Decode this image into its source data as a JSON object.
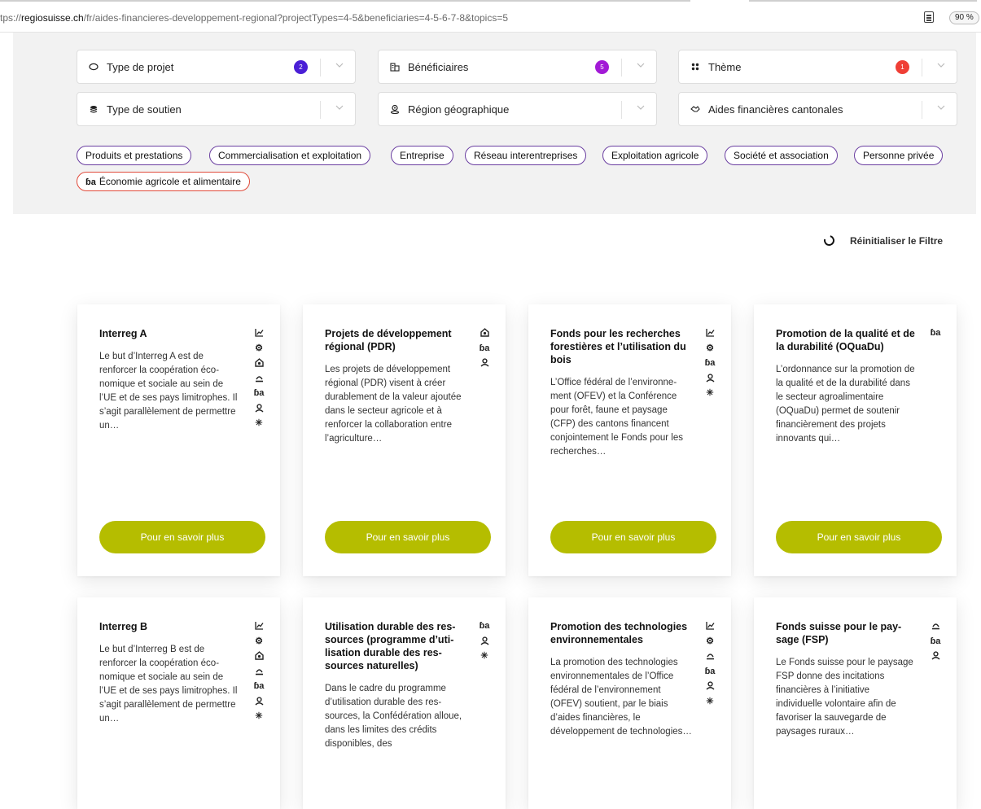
{
  "browser": {
    "url_prefix": "tps://",
    "url_domain": "regiosuisse.ch",
    "url_path": "/fr/aides-financieres-developpement-regional?projectTypes=4-5&beneficiaries=4-5-6-7-8&topics=5",
    "zoom": "90 %",
    "reader_icon": "reader-view-icon"
  },
  "filters": {
    "type_projet": {
      "label": "Type de projet",
      "badge": "2",
      "badge_color": "#4a1fd6",
      "icon": "circle-outline-icon"
    },
    "beneficiaires": {
      "label": "Bénéficiaires",
      "badge": "5",
      "badge_color": "#a21ad6",
      "icon": "building-icon"
    },
    "theme": {
      "label": "Thème",
      "badge": "1",
      "badge_color": "#ef3f36",
      "icon": "grid-icon"
    },
    "type_soutien": {
      "label": "Type de soutien",
      "icon": "coins-icon"
    },
    "region": {
      "label": "Région géographique",
      "icon": "location-icon"
    },
    "cantonales": {
      "label": "Aides financières cantonales",
      "icon": "handshake-icon"
    }
  },
  "chips": [
    {
      "label": "Produits et prestations"
    },
    {
      "label": "Commercialisation et exploitation"
    },
    {
      "label": "Entreprise"
    },
    {
      "label": "Réseau interentreprises"
    },
    {
      "label": "Exploitation agricole"
    },
    {
      "label": "Société et association"
    },
    {
      "label": "Personne privée"
    },
    {
      "label": "Économie agricole et alimentaire",
      "icon": "tractor-icon"
    }
  ],
  "reset_label": "Réinitialiser le Filtre",
  "button_label": "Pour en savoir plus",
  "cards": [
    {
      "title": "Interreg A",
      "desc": "Le but d’Interreg A est de renforcer la coopération éco­nomique et sociale au sein de l’UE et de ses pays limi­trophes. Il s’agit parallèle­ment de permettre un…",
      "icons": [
        "chart-icon",
        "gear-icon",
        "house-icon",
        "hand-icon",
        "tractor-icon",
        "person-icon",
        "sun-icon"
      ]
    },
    {
      "title": "Projets de développement régional (PDR)",
      "desc": "Les projets de développe­ment régional (PDR) visent à créer durablement de la va­leur ajoutée dans le secteur agricole et à renforcer la col­laboration entre l’agricul­ture…",
      "icons": [
        "house-icon",
        "tractor-icon",
        "person-icon"
      ]
    },
    {
      "title": "Fonds pour les recherches forestières et l’utilisation du bois",
      "desc": "L’Office fédéral de l’environne­ment (OFEV) et la Conférence pour forêt, faune et paysage (CFP) des can­tons financent conjointement le Fonds pour les re­cherches…",
      "icons": [
        "chart-icon",
        "gear-icon",
        "tractor-icon",
        "person-icon",
        "sun-icon"
      ]
    },
    {
      "title": "Promotion de la qualité et de la durabilité (OQuaDu)",
      "desc": "L’ordonnance sur la promo­tion de la qualité et de la du­rabilité dans le secteur agroa­limentaire (OQuaDu) permet de soutenir financièrement des projets innovants qui…",
      "icons": [
        "tractor-icon"
      ]
    },
    {
      "title": "Interreg B",
      "desc": "Le but d’Interreg B est de renforcer la coopération éco­nomique et sociale au sein de l’UE et de ses pays limi­trophes. Il s’agit parallèle­ment de permettre un…",
      "icons": [
        "chart-icon",
        "gear-icon",
        "house-icon",
        "hand-icon",
        "tractor-icon",
        "person-icon",
        "sun-icon"
      ]
    },
    {
      "title": "Utilisation durable des res­sources (programme d’uti­lisation durable des res­sources naturelles)",
      "desc": "Dans le cadre du programme d’utilisation durable des res­sources, la Confédération al­loue, dans les limites des crédits disponibles, des",
      "icons": [
        "tractor-icon",
        "person-icon",
        "sun-icon"
      ]
    },
    {
      "title": "Promotion des technolo­gies environnementales",
      "desc": "La promotion des technolo­gies environnementales de l’Office fédéral de l’environne­ment (OFEV) soutient, par le biais d’aides financières, le développement de technolo­gies…",
      "icons": [
        "chart-icon",
        "gear-icon",
        "hand-icon",
        "tractor-icon",
        "person-icon",
        "sun-icon"
      ]
    },
    {
      "title": "Fonds suisse pour le pay­sage (FSP)",
      "desc": "Le Fonds suisse pour le pay­sage FSP donne des incita­tions financières à l’initiative individuelle volontaire afin de favoriser la sauvegarde de paysages ruraux…",
      "icons": [
        "hand-icon",
        "tractor-icon",
        "person-icon"
      ]
    }
  ]
}
